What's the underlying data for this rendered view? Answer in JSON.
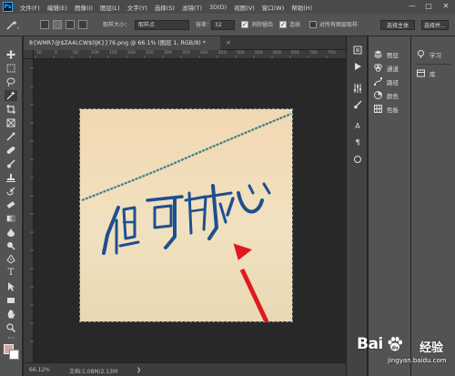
{
  "app": {
    "logo_text": "Ps"
  },
  "menu": [
    "文件(F)",
    "编辑(E)",
    "图像(I)",
    "图层(L)",
    "文字(Y)",
    "选择(S)",
    "滤镜(T)",
    "3D(D)",
    "视图(V)",
    "窗口(W)",
    "帮助(H)"
  ],
  "window_controls": {
    "minimize": "—",
    "maximize": "□",
    "close": "✕"
  },
  "options": {
    "sample_size_label": "取样大小：",
    "sample_size_value": "取样点",
    "tolerance_label": "容差：",
    "tolerance_value": "32",
    "antialias_label": "消除锯齿",
    "antialias_checked": true,
    "contiguous_label": "连续",
    "contiguous_checked": true,
    "sample_all_layers_label": "对所有图层取样",
    "sample_all_layers_checked": false,
    "select_subject_label": "选择主体",
    "select_and_mask_label": "选择并..."
  },
  "document": {
    "tab_title": "8{WMR7@$ZA4LCW$0JK}}76.png @ 66.1% (图层 1, RGB/8) *",
    "tab_close": "×"
  },
  "rulers": {
    "top": [
      "50",
      "0",
      "50",
      "100",
      "150",
      "200",
      "250",
      "300",
      "350",
      "400",
      "450",
      "500",
      "550",
      "600",
      "650",
      "700",
      "750"
    ]
  },
  "status": {
    "zoom": "66.12%",
    "doc_info": "文档:1.08M/2.13M",
    "arrow": "❯"
  },
  "panels": {
    "list": [
      {
        "label": "图层",
        "icon": "layers-icon"
      },
      {
        "label": "通道",
        "icon": "channels-icon"
      },
      {
        "label": "路径",
        "icon": "paths-icon"
      },
      {
        "label": "颜色",
        "icon": "color-icon"
      },
      {
        "label": "色板",
        "icon": "swatches-icon"
      }
    ],
    "right": [
      {
        "label": "学习",
        "icon": "learn-icon"
      },
      {
        "label": "库",
        "icon": "libraries-icon"
      }
    ]
  },
  "colors": {
    "foreground": "#d4a6a6",
    "background": "#ffffff",
    "ink": "#1e4f8f",
    "arrow": "#e0191f"
  },
  "watermark": {
    "brand_left": "Bai",
    "brand_right": "经验",
    "url": "jingyan.baidu.com"
  }
}
